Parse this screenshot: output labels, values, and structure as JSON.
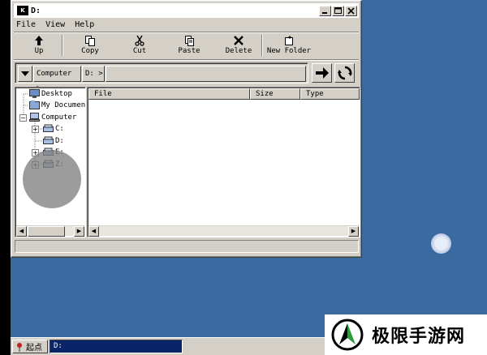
{
  "window": {
    "title": "D:",
    "app_icon_text": "K"
  },
  "menu": [
    "File",
    "View",
    "Help"
  ],
  "toolbar": {
    "up": "Up",
    "copy": "Copy",
    "cut": "Cut",
    "paste": "Paste",
    "delete": "Delete",
    "new_folder": "New Folder"
  },
  "address": {
    "crumbs": [
      "Computer",
      "D:"
    ]
  },
  "tree": {
    "items": [
      "Desktop",
      "My Documents",
      "Computer",
      "C:",
      "D:",
      "E:",
      "Z:"
    ]
  },
  "file_list": {
    "columns": [
      "File",
      "Size",
      "Type"
    ],
    "rows": []
  },
  "taskbar": {
    "start_label": "起点",
    "task_label": "D:"
  },
  "watermark": {
    "text": "极限手游网"
  },
  "colors": {
    "desktop": "#3a6aa0",
    "window": "#d4d0c8",
    "active_task": "#0a246a"
  }
}
